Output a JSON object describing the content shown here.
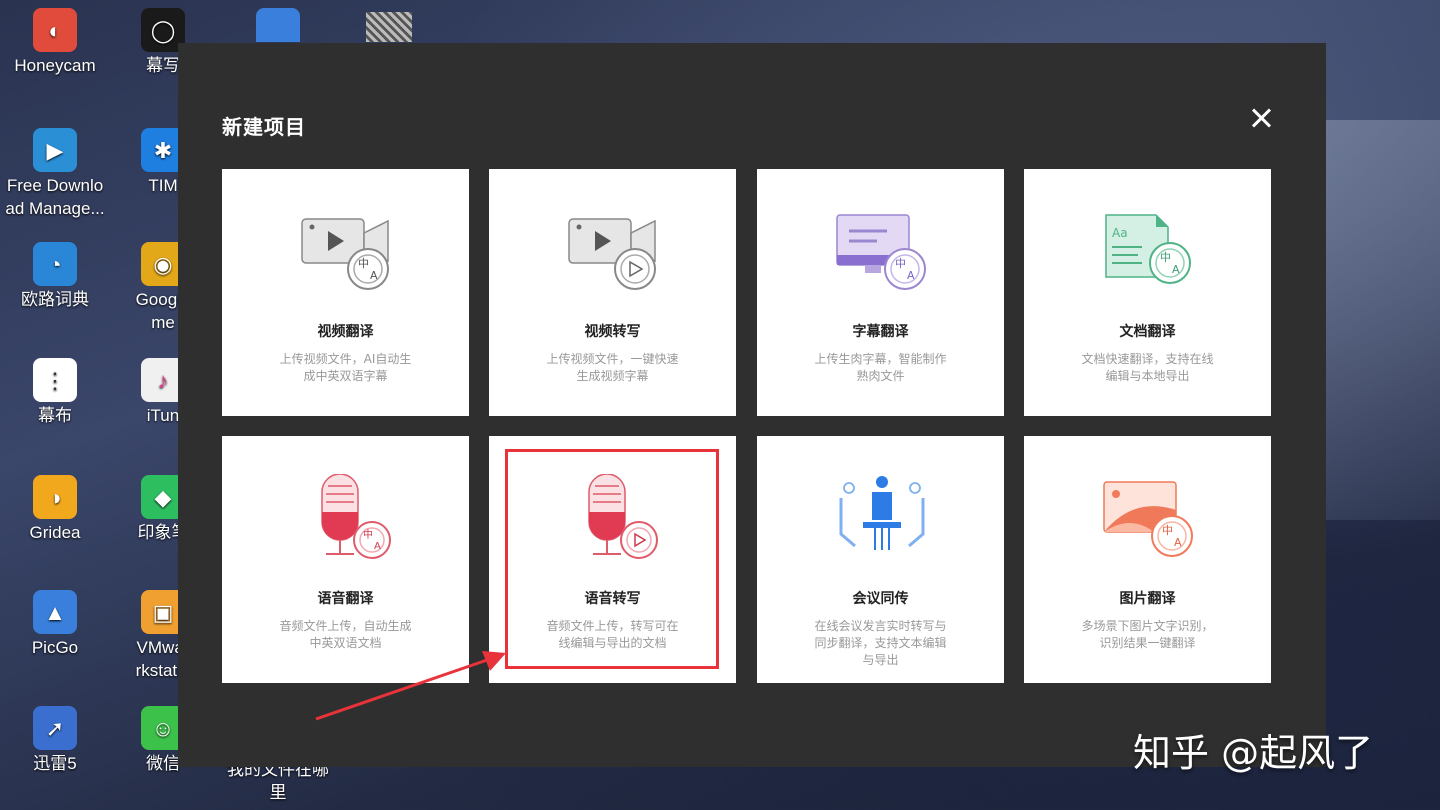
{
  "desktop": {
    "icons": [
      {
        "label": "Honeycam",
        "color": "#e14b3b",
        "glyph": "◐"
      },
      {
        "label": "幕写",
        "color": "#1a1a1a",
        "glyph": "◯"
      },
      {
        "label": "Free Downlo\nad Manage...",
        "color": "#2b8fd6",
        "glyph": "▶"
      },
      {
        "label": "TIM",
        "color": "#1f7fe0",
        "glyph": "✱"
      },
      {
        "label": "欧路词典",
        "color": "#2a87d8",
        "glyph": "◔"
      },
      {
        "label": "Google\nme",
        "color": "#e3a71a",
        "glyph": "◉"
      },
      {
        "label": "幕布",
        "color": "#ffffff",
        "glyph": "⋮"
      },
      {
        "label": "iTun",
        "color": "#f0f0f0",
        "glyph": "♪"
      },
      {
        "label": "Gridea",
        "color": "#f2a81d",
        "glyph": "◑"
      },
      {
        "label": "印象笔",
        "color": "#2dbe60",
        "glyph": "◆"
      },
      {
        "label": "PicGo",
        "color": "#3a7fdb",
        "glyph": "▲"
      },
      {
        "label": "VMwar\nrkstatio",
        "color": "#f0a030",
        "glyph": "▣"
      },
      {
        "label": "迅雷5",
        "color": "#3a6fd0",
        "glyph": "➚"
      },
      {
        "label": "微信",
        "color": "#3cc24a",
        "glyph": "☺"
      }
    ],
    "partial_label": "我的文件在哪\n里"
  },
  "dialog": {
    "title": "新建项目",
    "close_icon": "close-icon",
    "cards": [
      {
        "title": "视频翻译",
        "desc": "上传视频文件，AI自动生成中英双语字幕",
        "icon": "video-translate-icon"
      },
      {
        "title": "视频转写",
        "desc": "上传视频文件，一键快速生成视频字幕",
        "icon": "video-transcribe-icon"
      },
      {
        "title": "字幕翻译",
        "desc": "上传生肉字幕，智能制作熟肉文件",
        "icon": "subtitle-translate-icon"
      },
      {
        "title": "文档翻译",
        "desc": "文档快速翻译，支持在线编辑与本地导出",
        "icon": "document-translate-icon"
      },
      {
        "title": "语音翻译",
        "desc": "音频文件上传，自动生成中英双语文档",
        "icon": "audio-translate-icon"
      },
      {
        "title": "语音转写",
        "desc": "音频文件上传，转写可在线编辑与导出的文档",
        "icon": "audio-transcribe-icon"
      },
      {
        "title": "会议同传",
        "desc": "在线会议发言实时转写与同步翻译，支持文本编辑与导出",
        "icon": "meeting-interpret-icon"
      },
      {
        "title": "图片翻译",
        "desc": "多场景下图片文字识别，识别结果一键翻译",
        "icon": "image-translate-icon"
      }
    ]
  },
  "annotation": {
    "color": "#e8333b"
  },
  "watermark": "知乎 @起风了"
}
